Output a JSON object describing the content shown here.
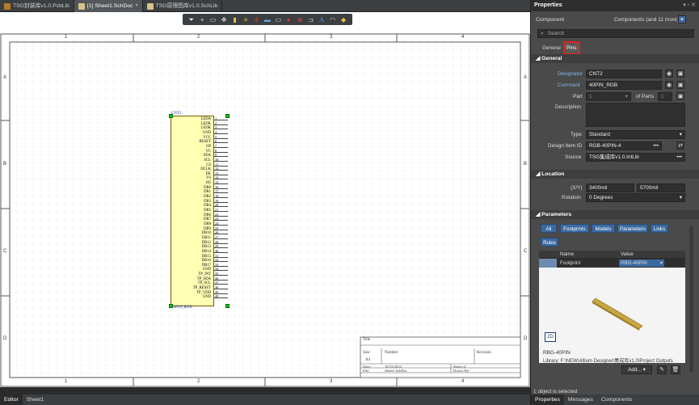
{
  "tabs": [
    {
      "label": "TSG封装库v1.0.PcbLib"
    },
    {
      "label": "[1] Sheet1.SchDoc"
    },
    {
      "label": "TSG原理图库v1.0.SchLib"
    }
  ],
  "toolbar": {
    "icons": [
      "filter-icon",
      "add-icon",
      "rect-select-icon",
      "move-icon",
      "align-icon",
      "highlight-icon",
      "power-icon",
      "bus-icon",
      "net-label-icon",
      "port-icon",
      "no-erc-icon",
      "harness-icon",
      "text-icon",
      "arc-icon",
      "shape-icon"
    ]
  },
  "sheet": {
    "col_labels": [
      "1",
      "2",
      "3",
      "4"
    ],
    "row_labels": [
      "A",
      "B",
      "C",
      "D"
    ],
    "component": {
      "designator": "CNT2",
      "comment": "40PIN_RGB",
      "pins": [
        {
          "name": "LEDA",
          "num": "1"
        },
        {
          "name": "LEDK",
          "num": "2"
        },
        {
          "name": "LEDK",
          "num": "3"
        },
        {
          "name": "GND",
          "num": "4"
        },
        {
          "name": "VCC",
          "num": "5"
        },
        {
          "name": "RESET",
          "num": "6"
        },
        {
          "name": "OP",
          "num": "7"
        },
        {
          "name": "VC",
          "num": "8"
        },
        {
          "name": "SDA",
          "num": "9"
        },
        {
          "name": "SCL",
          "num": "10"
        },
        {
          "name": "CS",
          "num": "11"
        },
        {
          "name": "DCLK",
          "num": "12"
        },
        {
          "name": "DE",
          "num": "13"
        },
        {
          "name": "VS",
          "num": "14"
        },
        {
          "name": "HS",
          "num": "15"
        },
        {
          "name": "DB0",
          "num": "16"
        },
        {
          "name": "DB1",
          "num": "17"
        },
        {
          "name": "DB2",
          "num": "18"
        },
        {
          "name": "DB3",
          "num": "19"
        },
        {
          "name": "DB4",
          "num": "20"
        },
        {
          "name": "DB5",
          "num": "21"
        },
        {
          "name": "DB6",
          "num": "22"
        },
        {
          "name": "DB7",
          "num": "23"
        },
        {
          "name": "DB8",
          "num": "24"
        },
        {
          "name": "DB9",
          "num": "25"
        },
        {
          "name": "DB10",
          "num": "26"
        },
        {
          "name": "DB11",
          "num": "27"
        },
        {
          "name": "DB12",
          "num": "28"
        },
        {
          "name": "DB13",
          "num": "29"
        },
        {
          "name": "DB14",
          "num": "30"
        },
        {
          "name": "DB15",
          "num": "31"
        },
        {
          "name": "DB16",
          "num": "32"
        },
        {
          "name": "DB17",
          "num": "33"
        },
        {
          "name": "GND",
          "num": "34"
        },
        {
          "name": "TP_INT",
          "num": "35"
        },
        {
          "name": "TP_SDA",
          "num": "36"
        },
        {
          "name": "TP_SCL",
          "num": "37"
        },
        {
          "name": "TP_RESET",
          "num": "38"
        },
        {
          "name": "TP_VDD",
          "num": "39"
        },
        {
          "name": "GND",
          "num": "40"
        }
      ]
    },
    "title_block": {
      "title": "Title",
      "size_label": "Size",
      "size": "A4",
      "number_label": "Number",
      "revision_label": "Revision",
      "date_label": "Date:",
      "date": "10/15/2022",
      "file_label": "File:",
      "file": "Sheet1.SchDoc",
      "sheet_label": "Sheet   of",
      "drawn_label": "Drawn By:"
    }
  },
  "statusbar": {
    "tabs": [
      "Editor",
      "Sheet1"
    ]
  },
  "panel": {
    "title": "Properties",
    "kind": "Component",
    "selection": "Components (and 11 more)",
    "search_placeholder": "Search",
    "tabs": [
      "General",
      "Pins"
    ],
    "general_header": "General",
    "designator_label": "Designator",
    "designator": "CNT2",
    "comment_label": "Comment",
    "comment": "40PIN_RGB",
    "part_label": "Part",
    "part": "1",
    "of_parts_label": "of Parts",
    "of_parts": "1",
    "description_label": "Description",
    "type_label": "Type",
    "type": "Standard",
    "design_item_label": "Design Item ID",
    "design_item": "RGB-40PIN-4",
    "source_label": "Source",
    "source": "TSG集成库v1.0.IntLib",
    "location_header": "Location",
    "xy_label": "(X/Y)",
    "x": "3400mil",
    "y": "5700mil",
    "rotation_label": "Rotation",
    "rotation": "0 Degrees",
    "parameters_header": "Parameters",
    "param_buttons": [
      "All",
      "Footprints",
      "Models",
      "Parameters",
      "Links",
      "Rules"
    ],
    "table_headers": [
      "Name",
      "Value"
    ],
    "table_row": {
      "name": "Footprint",
      "value": "RBG-40PIN"
    },
    "preview_badge": "2D",
    "preview_name": "RBG-40PIN",
    "preview_library": "Library: F:\\NEW\\Altium Designer\\集成库v1.0\\Project Outputs",
    "add_button": "Add...",
    "status": "1 object is selected",
    "bottom_tabs": [
      "Properties",
      "Messages",
      "Components"
    ]
  },
  "colors": {
    "accent": "#3a6aa0",
    "highlight_box": "#e02020",
    "component_fill": "#ffffb3",
    "handle": "#20c020"
  }
}
